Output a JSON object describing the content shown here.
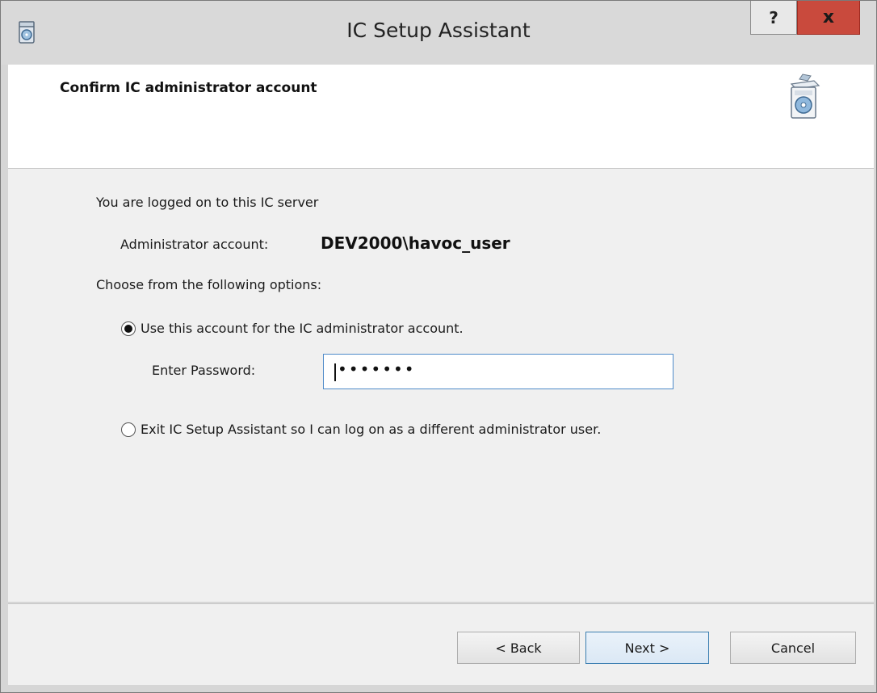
{
  "window": {
    "title": "IC Setup Assistant",
    "help_label": "?",
    "close_label": "x"
  },
  "header": {
    "title": "Confirm IC administrator account"
  },
  "content": {
    "logged_on_text": "You are logged on to this IC server",
    "account_label": "Administrator account:",
    "account_value": "DEV2000\\havoc_user",
    "choose_text": "Choose from the following options:",
    "option_use_label": "Use this account for the IC administrator account.",
    "option_use_selected": true,
    "password_label": "Enter Password:",
    "password_mask": "•••••••",
    "option_exit_label": "Exit IC Setup Assistant so I can log on as a different administrator user.",
    "option_exit_selected": false
  },
  "footer": {
    "back_label": "< Back",
    "next_label": "Next >",
    "cancel_label": "Cancel"
  }
}
